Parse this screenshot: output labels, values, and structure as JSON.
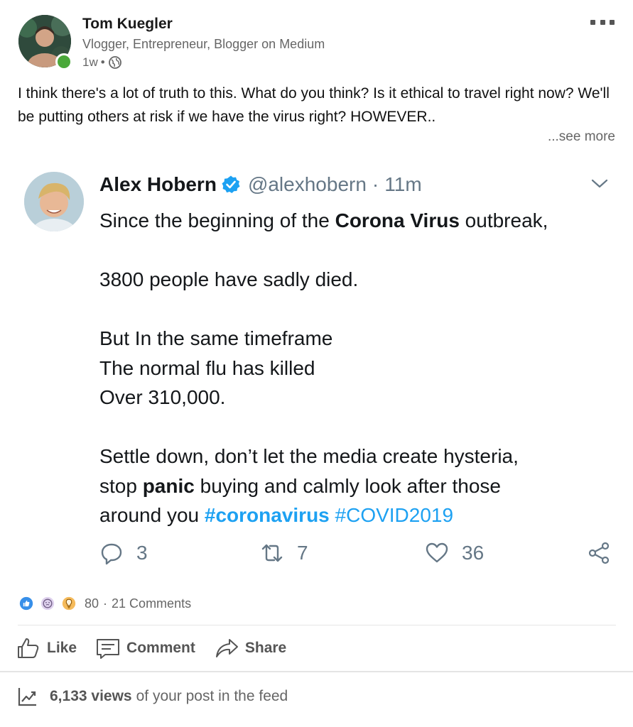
{
  "post": {
    "author_name": "Tom Kuegler",
    "author_headline": "Vlogger, Entrepreneur, Blogger on Medium",
    "time": "1w",
    "bullet": "•",
    "text": "I think there's a lot of truth to this. What do you think? Is it ethical to travel right now? We'll be putting others at risk if we have the virus right? HOWEVER..",
    "see_more": "...see more",
    "icons": {
      "more": "more-options-icon",
      "visibility": "globe-icon",
      "presence": "online-status-dot"
    },
    "colors": {
      "presence": "#4aa83a",
      "muted_text": "#666666"
    }
  },
  "tweet": {
    "name": "Alex Hobern",
    "handle": "@alexhobern",
    "separator": "·",
    "time": "11m",
    "line1_pre": "Since the beginning of the ",
    "line1_bold": "Corona Virus",
    "line1_post": " outbreak,",
    "line2": "3800 people have sadly died.",
    "line3": "But In the same timeframe",
    "line4": "The normal flu has killed",
    "line5": "Over 310,000.",
    "line6": "Settle down, don’t let the media create hysteria,",
    "line7_pre": "stop ",
    "line7_bold": "panic",
    "line7_post": " buying and calmly look after those",
    "line8_pre": "around you ",
    "hashtag1": "#coronavirus",
    "hashtag2": "#COVID2019",
    "replies": "3",
    "retweets": "7",
    "likes": "36",
    "colors": {
      "link": "#1da1f2",
      "verified": "#1da1f2",
      "secondary": "#657786"
    }
  },
  "social": {
    "reactions_count": "80",
    "dot": "·",
    "comments": "21 Comments",
    "reaction_icons": [
      "like-reaction-icon",
      "curious-reaction-icon",
      "insightful-reaction-icon"
    ]
  },
  "actions": {
    "like": "Like",
    "comment": "Comment",
    "share": "Share"
  },
  "views": {
    "count": "6,133 views",
    "suffix": "of your post in the feed"
  }
}
